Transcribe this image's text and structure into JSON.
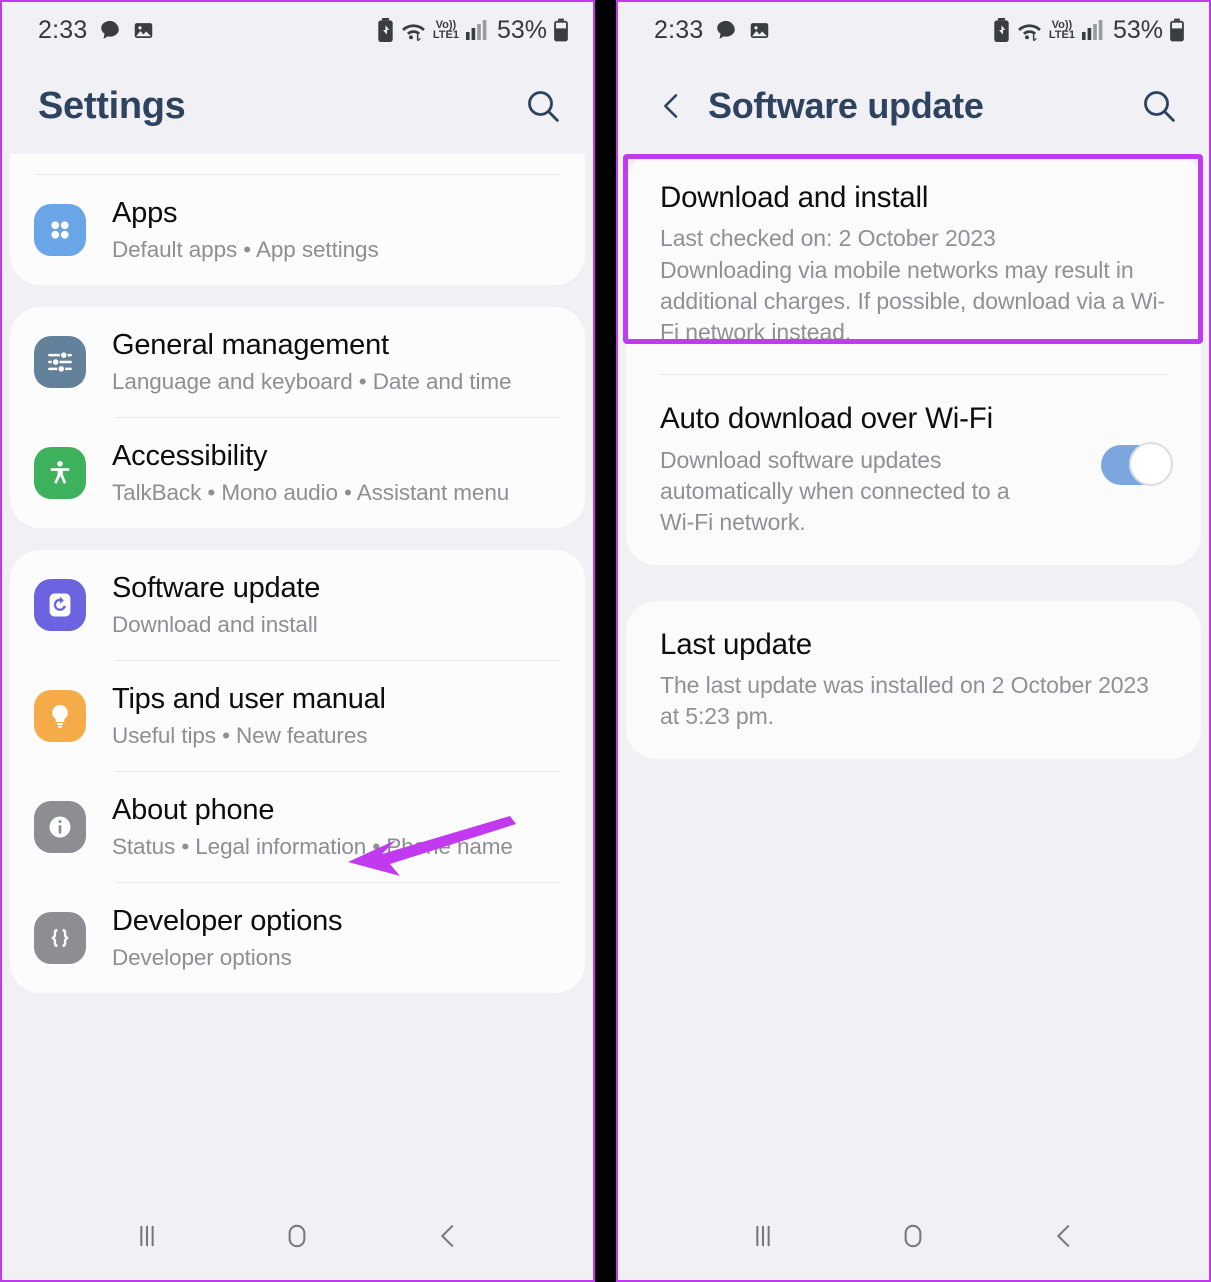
{
  "status_bar": {
    "time": "2:33",
    "left_icons": [
      "message-bubble-icon",
      "photo-icon"
    ],
    "right_icons": [
      "battery-saver-icon",
      "wifi-icon",
      "volte-lte1-icon",
      "signal-bars-icon"
    ],
    "volte_label": "Vo))",
    "lte_label": "LTE1",
    "battery_percent": "53%"
  },
  "left_screen": {
    "header": {
      "title": "Settings",
      "search_icon": "search-icon"
    },
    "groups": [
      {
        "items": [
          {
            "title": "Apps",
            "subtitle": "Default apps  •  App settings",
            "icon": "apps-grid-icon",
            "color": "#6aa5e8"
          }
        ]
      },
      {
        "items": [
          {
            "title": "General management",
            "subtitle": "Language and keyboard  •  Date and time",
            "icon": "sliders-icon",
            "color": "#64819b"
          },
          {
            "title": "Accessibility",
            "subtitle": "TalkBack  •  Mono audio  •  Assistant menu",
            "icon": "accessibility-person-icon",
            "color": "#3db15c"
          }
        ]
      },
      {
        "items": [
          {
            "title": "Software update",
            "subtitle": "Download and install",
            "icon": "software-update-refresh-icon",
            "color": "#6c63e0"
          },
          {
            "title": "Tips and user manual",
            "subtitle": "Useful tips  •  New features",
            "icon": "lightbulb-icon",
            "color": "#f6ab49"
          },
          {
            "title": "About phone",
            "subtitle": "Status  •  Legal information  •  Phone name",
            "icon": "info-circle-icon",
            "color": "#8d8d94"
          },
          {
            "title": "Developer options",
            "subtitle": "Developer options",
            "icon": "braces-code-icon",
            "color": "#8d8d94"
          }
        ]
      }
    ]
  },
  "right_screen": {
    "header": {
      "title": "Software update",
      "back_icon": "back-chevron-icon",
      "search_icon": "search-icon"
    },
    "sections": [
      {
        "title": "Download and install",
        "description": "Last checked on: 2 October 2023\nDownloading via mobile networks may result in additional charges. If possible, download via a Wi-Fi network instead.",
        "highlighted": true
      },
      {
        "title": "Auto download over Wi-Fi",
        "description": "Download software updates automatically when connected to a Wi-Fi network.",
        "toggle": {
          "state": "on"
        }
      },
      {
        "title": "Last update",
        "description": "The last update was installed on 2 October 2023 at 5:23 pm."
      }
    ]
  },
  "nav_bar": {
    "recents_icon": "recents-icon",
    "home_icon": "home-icon",
    "back_icon": "back-icon"
  },
  "annotations": {
    "arrow_color": "#c23af0",
    "highlight_color": "#c23af0",
    "arrow_target": "Software update"
  }
}
